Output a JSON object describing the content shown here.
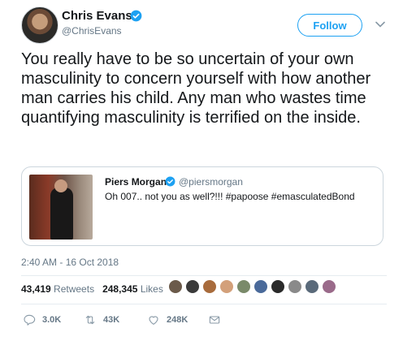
{
  "colors": {
    "accent": "#1da1f2",
    "text": "#14171a",
    "muted": "#657786",
    "border": "#ccd6dd"
  },
  "author": {
    "name": "Chris Evans",
    "handle": "@ChrisEvans",
    "verified_icon": "verified-badge-icon"
  },
  "follow_label": "Follow",
  "tweet_text": "You really have to be so uncertain of your own masculinity to concern yourself with how another man carries his child. Any man who wastes time quantifying masculinity is terrified on the inside.",
  "quoted": {
    "name": "Piers Morgan",
    "handle": "@piersmorgan",
    "text": "Oh 007.. not you as well?!!! #papoose #emasculatedBond"
  },
  "timestamp": "2:40 AM - 16 Oct 2018",
  "stats": {
    "retweets_count": "43,419",
    "retweets_label": "Retweets",
    "likes_count": "248,345",
    "likes_label": "Likes"
  },
  "likers": [
    "#6b5a4a",
    "#3a3a3a",
    "#a86b3c",
    "#d3a07a",
    "#7a8a6a",
    "#4a6a9a",
    "#2a2a2a",
    "#8a8a8a",
    "#5a6a7a",
    "#9a6a8a"
  ],
  "actions": {
    "reply_count": "3.0K",
    "retweet_count": "43K",
    "like_count": "248K"
  }
}
